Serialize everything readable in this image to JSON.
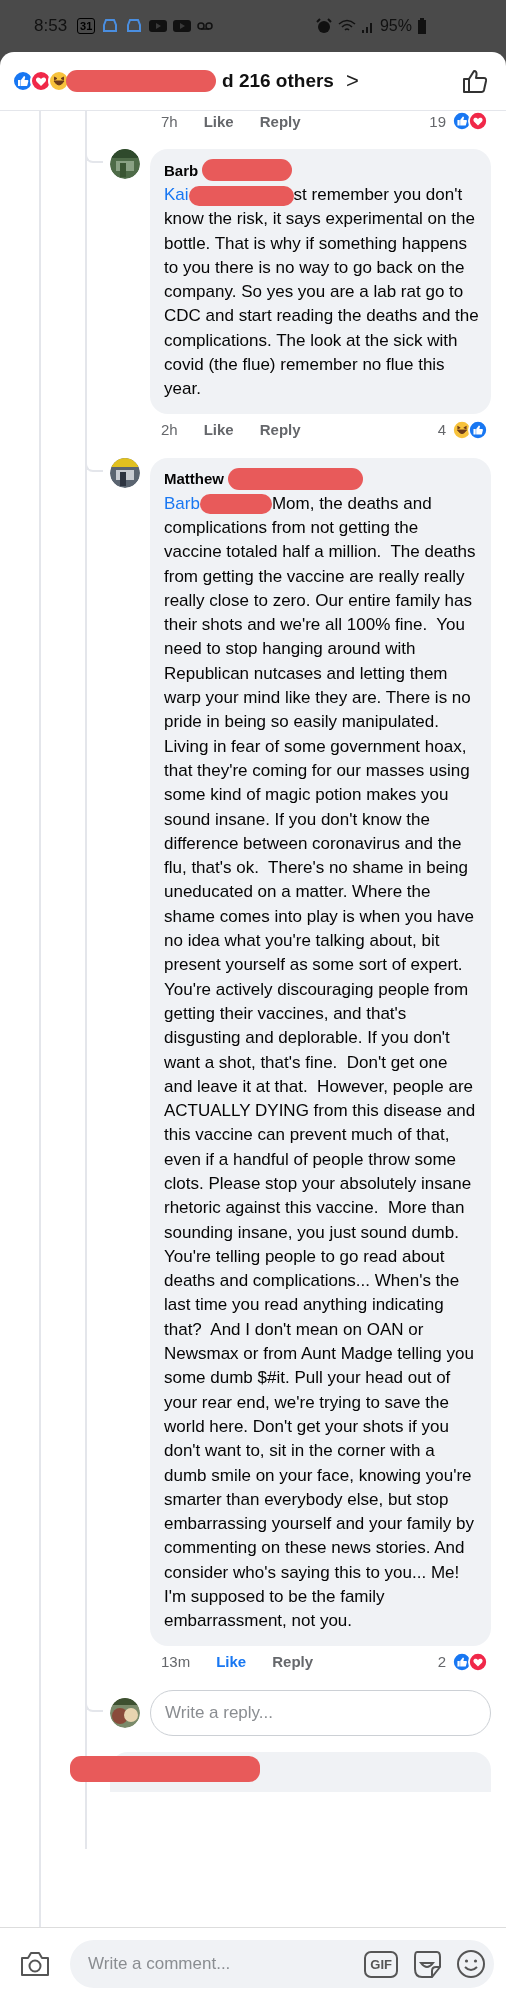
{
  "status_bar": {
    "time": "8:53",
    "calendar_day": "31",
    "battery": "95%"
  },
  "reactions_header": {
    "text": "d 216 others",
    "chevron": ">"
  },
  "previous_actions": {
    "time": "7h",
    "like": "Like",
    "liked": false,
    "reply": "Reply",
    "reaction_count": "19"
  },
  "comments": [
    {
      "author": "Barb",
      "mention": "Kai",
      "text": "st remember you don't know the risk, it says experimental on the bottle. That is why if something happens to you there is no way to go back on the company. So yes you are a lab rat go to CDC and start reading the deaths and the complications. The look at the sick with covid (the flue) remember no flue this year.",
      "time": "2h",
      "like": "Like",
      "liked": false,
      "reply": "Reply",
      "reaction_count": "4"
    },
    {
      "author": "Matthew",
      "mention": "Barb",
      "text": "Mom, the deaths and complications from not getting the vaccine totaled half a million.  The deaths from getting the vaccine are really really really close to zero. Our entire family has their shots and we're all 100% fine.  You need to stop hanging around with Republican nutcases and letting them warp your mind like they are. There is no pride in being so easily manipulated.  Living in fear of some government hoax, that they're coming for our masses using some kind of magic potion makes you sound insane. If you don't know the difference between coronavirus and the flu, that's ok.  There's no shame in being uneducated on a matter. Where the shame comes into play is when you have no idea what you're talking about, bit present yourself as some sort of expert. You're actively discouraging people from getting their vaccines, and that's disgusting and deplorable. If you don't want a shot, that's fine.  Don't get one and leave it at that.  However, people are ACTUALLY DYING from this disease and this vaccine can prevent much of that, even if a handful of people throw some clots. Please stop your absolutely insane rhetoric against this vaccine.  More than sounding insane, you just sound dumb. You're telling people to go read about deaths and complications... When's the last time you read anything indicating that?  And I don't mean on OAN or Newsmax or from Aunt Madge telling you some dumb $#it. Pull your head out of your rear end, we're trying to save the world here. Don't get your shots if you don't want to, sit in the corner with a dumb smile on your face, knowing you're smarter than everybody else, but stop embarrassing yourself and your family by commenting on these news stories. And consider who's saying this to you... Me!  I'm supposed to be the family embarrassment, not you.",
      "time": "13m",
      "like": "Like",
      "liked": true,
      "reply": "Reply",
      "reaction_count": "2"
    }
  ],
  "reply_box": {
    "placeholder": "Write a reply..."
  },
  "composer": {
    "placeholder": "Write a comment...",
    "gif": "GIF"
  }
}
